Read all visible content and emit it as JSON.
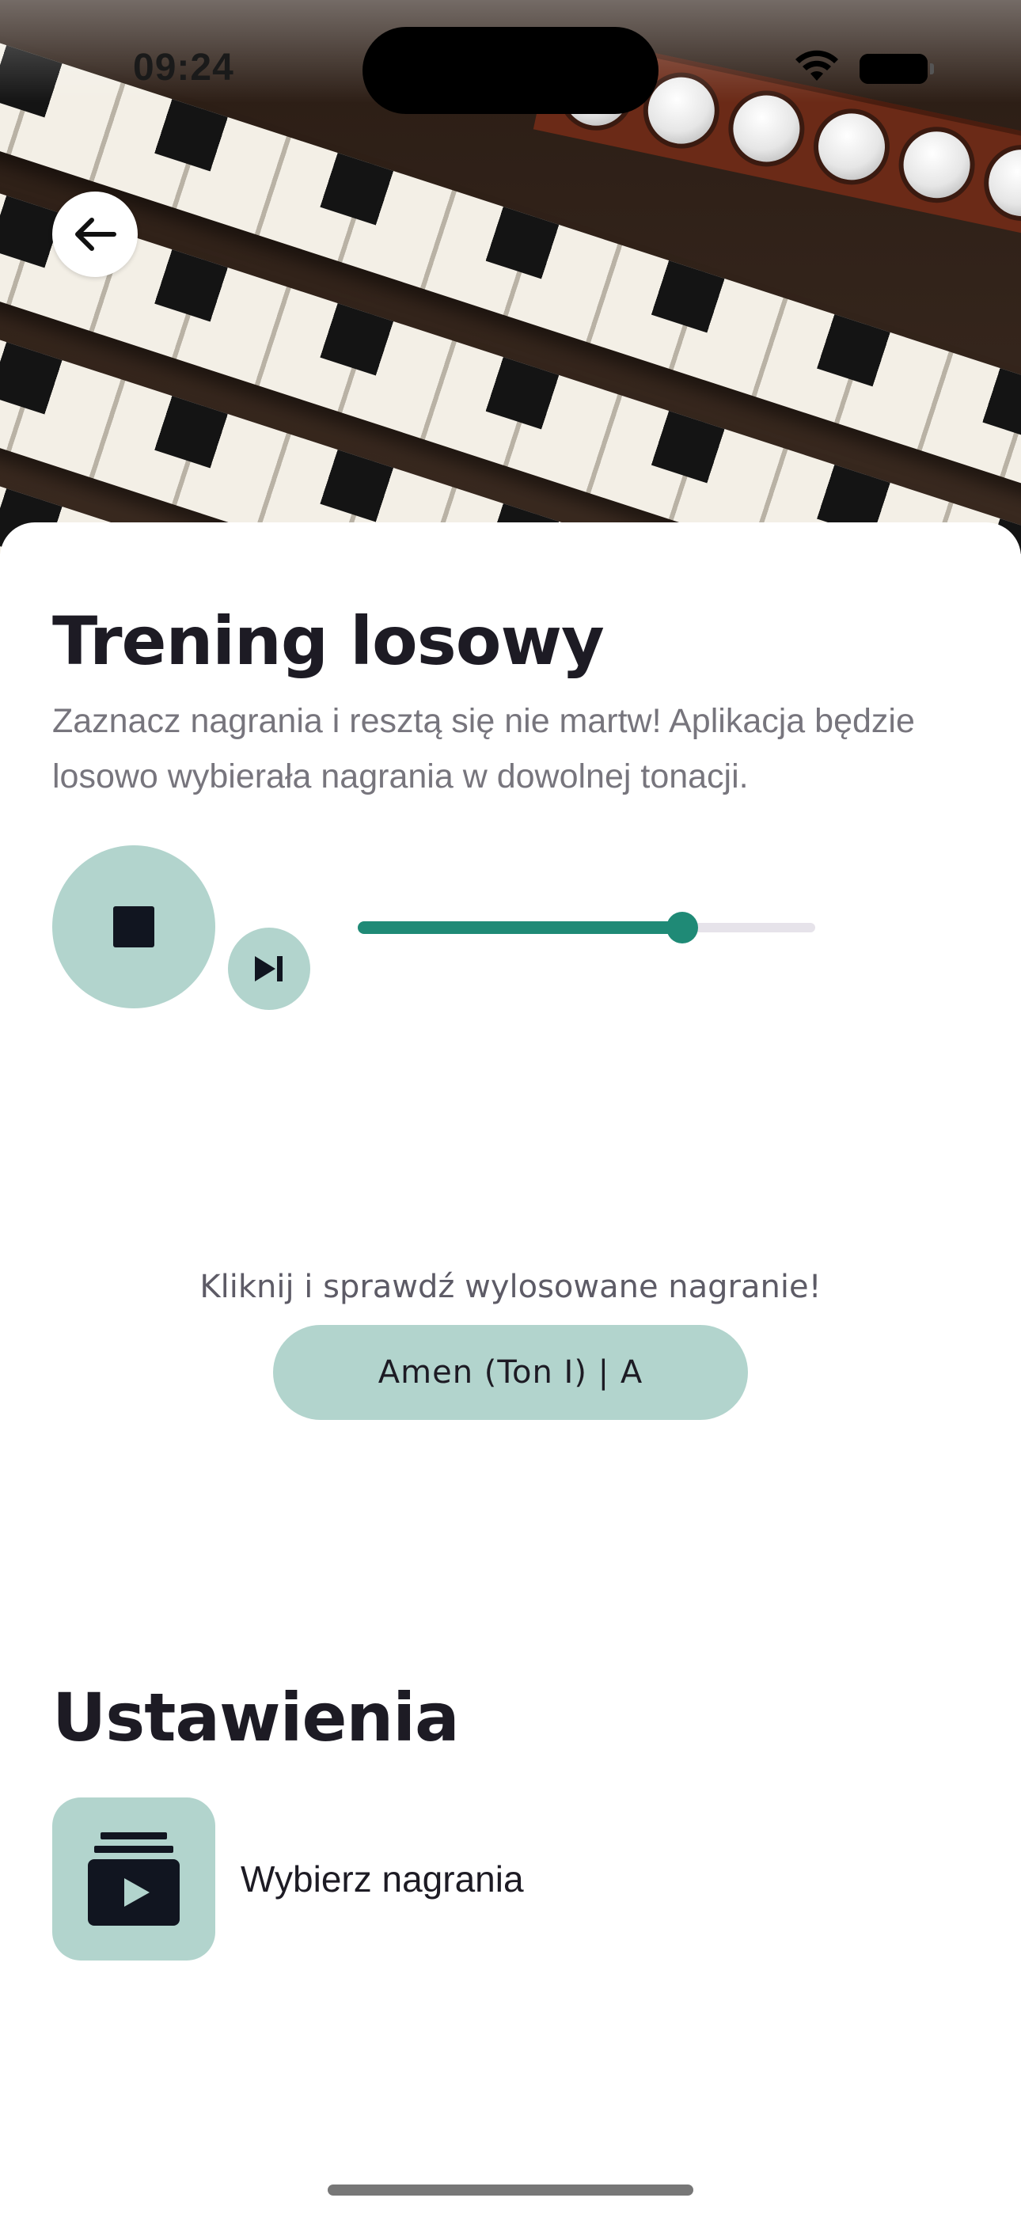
{
  "status_bar": {
    "time": "09:24"
  },
  "hero": {
    "image": "organ-keyboard-photo"
  },
  "header": {
    "back_icon": "arrow-left-icon"
  },
  "training": {
    "title": "Trening losowy",
    "description": "Zaznacz nagrania i resztą się nie martw! Aplikacja będzie losowo wybierała nagrania w dowolnej tonacji."
  },
  "player": {
    "stop_icon": "stop-icon",
    "skip_icon": "skip-next-icon",
    "progress": 0.71
  },
  "random_pick": {
    "hint": "Kliknij i sprawdź wylosowane nagranie!",
    "button_label": "Amen (Ton I) | A"
  },
  "settings": {
    "title": "Ustawienia",
    "items": [
      {
        "icon": "video-library-icon",
        "label": "Wybierz nagrania"
      }
    ]
  },
  "colors": {
    "accent": "#1f8a76",
    "accent_light": "#b2d4cd",
    "text_primary": "#1d1b24",
    "text_secondary": "#77757d",
    "track": "#e6e3ea"
  }
}
